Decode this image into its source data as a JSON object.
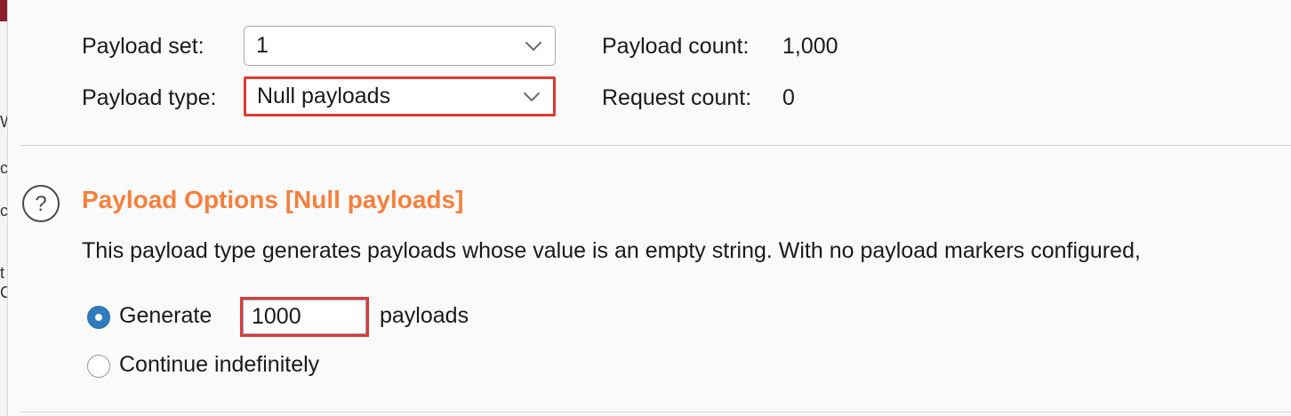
{
  "payload_set": {
    "label": "Payload set:",
    "value": "1"
  },
  "payload_type": {
    "label": "Payload type:",
    "value": "Null payloads"
  },
  "payload_count": {
    "label": "Payload count:",
    "value": "1,000"
  },
  "request_count": {
    "label": "Request count:",
    "value": "0"
  },
  "options": {
    "title": "Payload Options [Null payloads]",
    "description": "This payload type generates payloads whose value is an empty string. With no payload markers configured,",
    "generate_label": "Generate",
    "generate_value": "1000",
    "payloads_suffix": "payloads",
    "continue_label": "Continue indefinitely",
    "selected_mode": "Generate"
  },
  "icons": {
    "help": "help-icon",
    "dropdown": "chevron-down-icon",
    "radio_selected": "radio-selected-icon",
    "radio_unselected": "radio-unselected-icon"
  },
  "colors": {
    "section_title": "#f5803e",
    "highlight_border": "#e03a32",
    "radio_selected": "#2e7bbd"
  }
}
